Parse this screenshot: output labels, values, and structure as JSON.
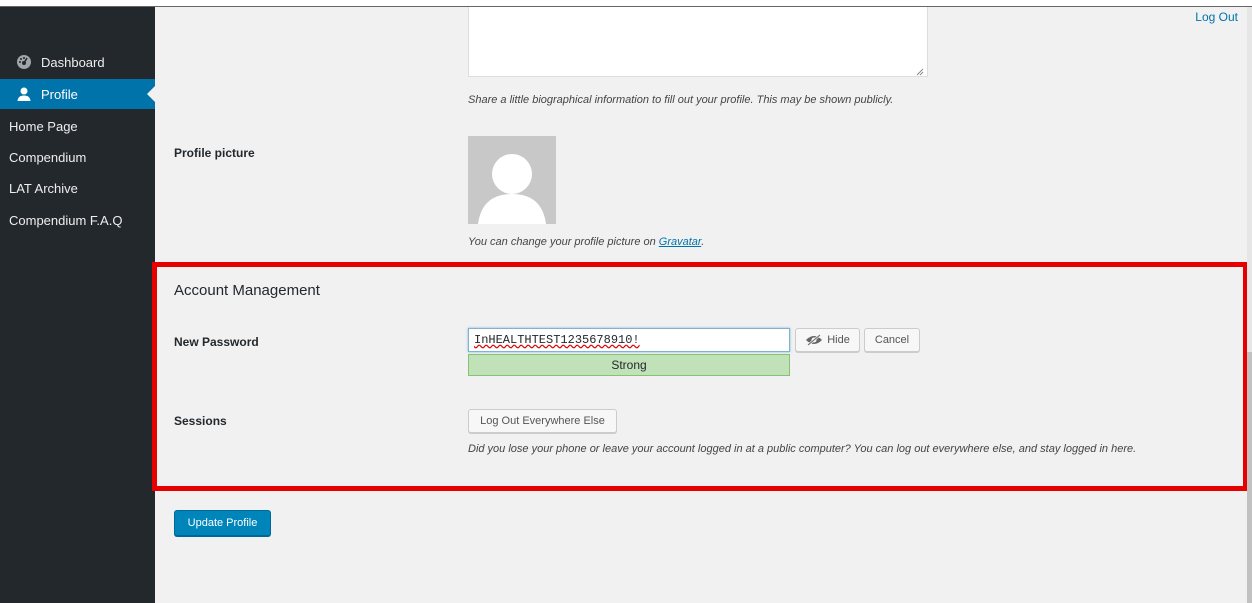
{
  "header": {
    "logout_label": "Log Out"
  },
  "sidebar": {
    "items": [
      {
        "label": "Dashboard",
        "icon": "dashboard-icon"
      },
      {
        "label": "Profile",
        "icon": "user-icon",
        "active": true
      },
      {
        "label": "Home Page"
      },
      {
        "label": "Compendium"
      },
      {
        "label": "LAT Archive"
      },
      {
        "label": "Compendium F.A.Q"
      }
    ]
  },
  "bio": {
    "description": "Share a little biographical information to fill out your profile. This may be shown publicly."
  },
  "profile_picture": {
    "label": "Profile picture",
    "description_prefix": "You can change your profile picture on ",
    "link_text": "Gravatar",
    "description_suffix": "."
  },
  "account": {
    "title": "Account Management",
    "new_password_label": "New Password",
    "password_value": "InHEALTHTEST1235678910!",
    "strength_label": "Strong",
    "hide_label": "Hide",
    "cancel_label": "Cancel",
    "sessions_label": "Sessions",
    "logout_everywhere_label": "Log Out Everywhere Else",
    "sessions_description": "Did you lose your phone or leave your account logged in at a public computer? You can log out everywhere else, and stay logged in here."
  },
  "update_button_label": "Update Profile",
  "colors": {
    "sidebar_bg": "#23282d",
    "accent": "#0073aa",
    "primary_button": "#0085ba",
    "highlight_border": "#e60000",
    "strength_bg": "#c1e1b9"
  }
}
